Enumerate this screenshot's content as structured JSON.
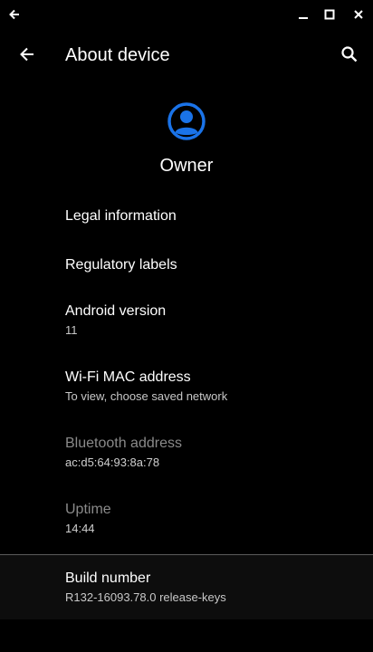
{
  "window": {
    "back_icon": "arrow-left-icon",
    "minimize_icon": "minimize-icon",
    "maximize_icon": "maximize-icon",
    "close_icon": "close-icon"
  },
  "appbar": {
    "title": "About device",
    "back_icon": "arrow-left-icon",
    "search_icon": "search-icon"
  },
  "profile": {
    "name": "Owner",
    "avatar_icon": "account-circle-icon",
    "avatar_color": "#1a73e8"
  },
  "items": [
    {
      "title": "Legal information"
    },
    {
      "title": "Regulatory labels"
    },
    {
      "title": "Android version",
      "summary": "11"
    },
    {
      "title": "Wi-Fi MAC address",
      "summary": "To view, choose saved network"
    },
    {
      "title": "Bluetooth address",
      "summary": "ac:d5:64:93:8a:78",
      "enabled": false
    },
    {
      "title": "Uptime",
      "summary": "14:44",
      "enabled": false
    }
  ],
  "build": {
    "title": "Build number",
    "summary": "R132-16093.78.0 release-keys"
  }
}
